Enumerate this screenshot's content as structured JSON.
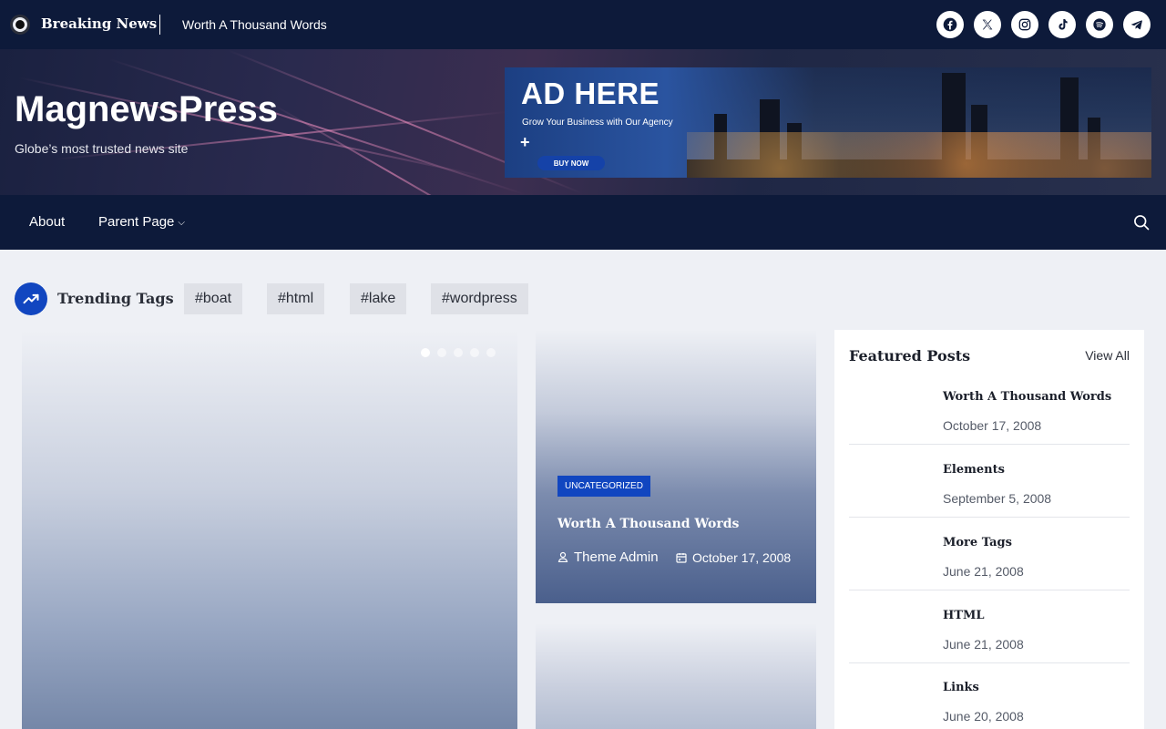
{
  "topbar": {
    "breaking_label": "Breaking News",
    "headline": "Worth A Thousand Words",
    "socials": [
      "facebook-icon",
      "x-icon",
      "instagram-icon",
      "tiktok-icon",
      "spotify-icon",
      "telegram-icon"
    ]
  },
  "header": {
    "site_title": "MagnewsPress",
    "tagline": "Globe’s most trusted news site",
    "ad": {
      "title": "AD HERE",
      "subtitle": "Grow Your Business with Our Agency",
      "plus": "+",
      "button": "BUY NOW"
    }
  },
  "nav": {
    "about": "About",
    "parent": "Parent Page",
    "parent_chevron": "⌵"
  },
  "trending": {
    "label": "Trending Tags",
    "tags": [
      "#boat",
      "#html",
      "#lake",
      "#wordpress"
    ]
  },
  "slider": {
    "slide_count": 5,
    "active_index": 0
  },
  "card": {
    "category": "UNCATEGORIZED",
    "title": "Worth A Thousand Words",
    "author": "Theme Admin",
    "date": "October 17, 2008"
  },
  "featured": {
    "title": "Featured Posts",
    "view_all": "View All",
    "items": [
      {
        "title": "Worth A Thousand Words",
        "date": "October 17, 2008"
      },
      {
        "title": "Elements",
        "date": "September 5, 2008"
      },
      {
        "title": "More Tags",
        "date": "June 21, 2008"
      },
      {
        "title": "HTML",
        "date": "June 21, 2008"
      },
      {
        "title": "Links",
        "date": "June 20, 2008"
      }
    ]
  },
  "colors": {
    "navy": "#0d1a3a",
    "accent": "#1146c0",
    "background": "#eef0f5"
  }
}
